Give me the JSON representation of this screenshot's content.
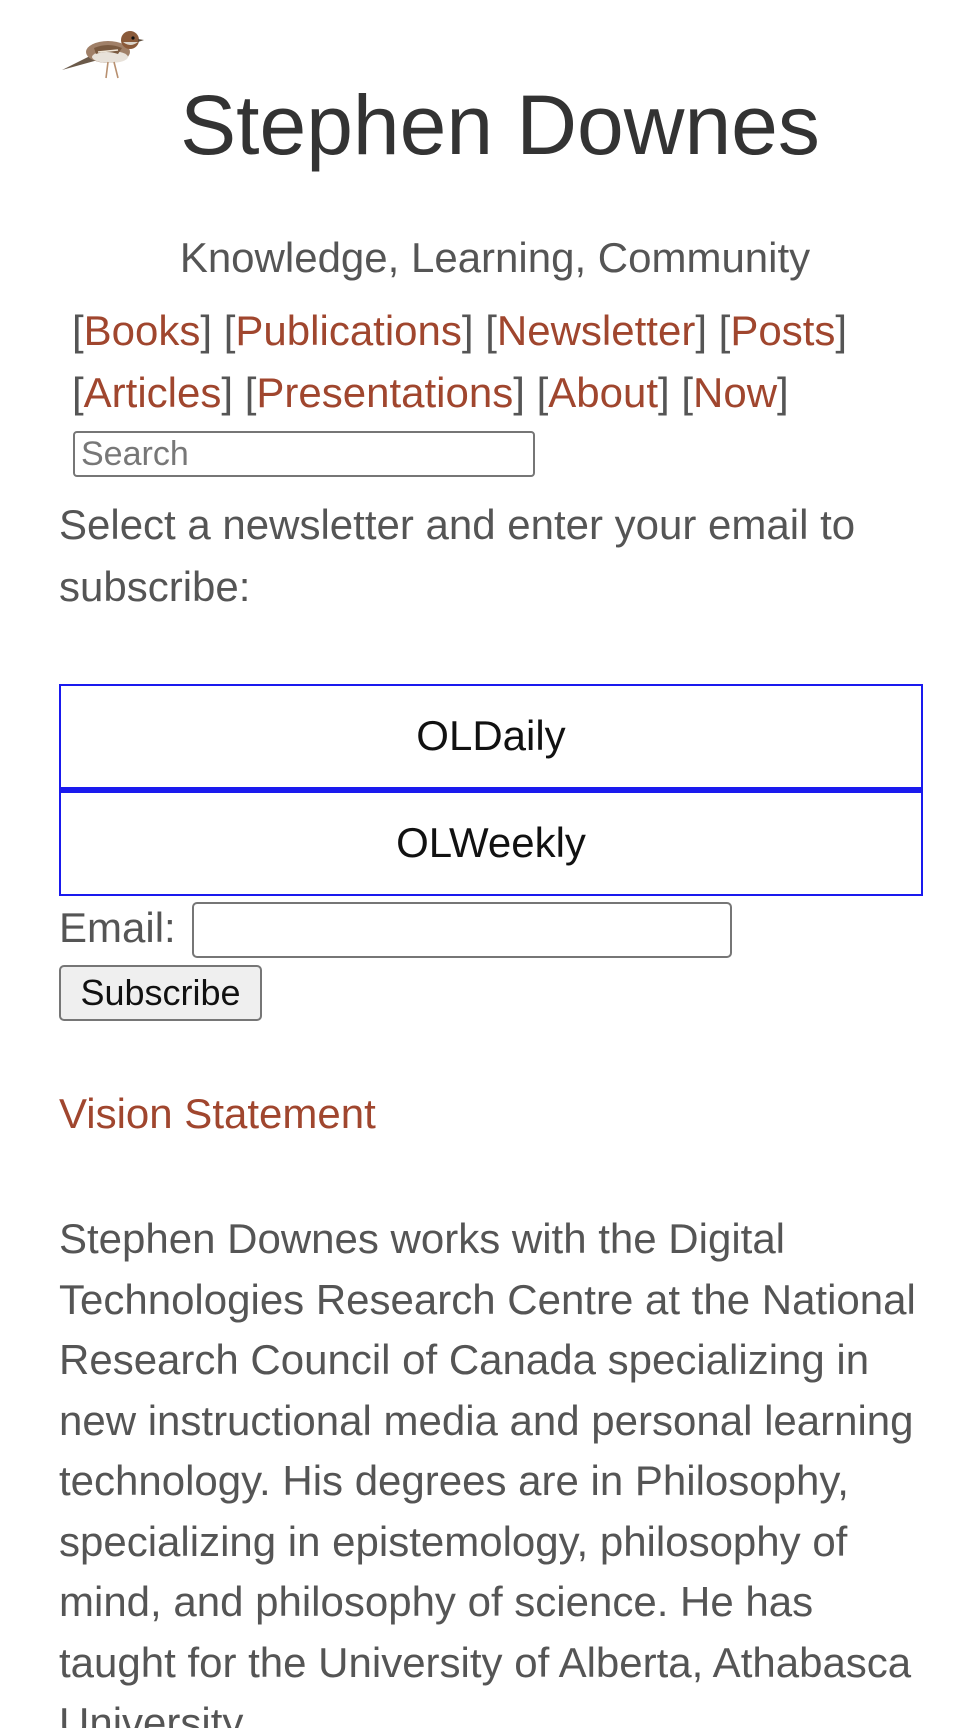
{
  "header": {
    "title": "Stephen Downes",
    "tagline": "Knowledge, Learning, Community",
    "logo_icon": "sparrow-bird-icon"
  },
  "nav": {
    "items": [
      {
        "label": "Books"
      },
      {
        "label": "Publications"
      },
      {
        "label": "Newsletter"
      },
      {
        "label": "Posts"
      },
      {
        "label": "Articles"
      },
      {
        "label": "Presentations"
      },
      {
        "label": "About"
      },
      {
        "label": "Now"
      }
    ]
  },
  "search": {
    "placeholder": "Search",
    "value": ""
  },
  "subscribe": {
    "intro": "Select a newsletter and enter your email to subscribe:",
    "options": [
      {
        "label": "OLDaily"
      },
      {
        "label": "OLWeekly"
      }
    ],
    "email_label": "Email:",
    "email_value": "",
    "button_label": "Subscribe",
    "option_border_color": "#1a1aee"
  },
  "vision": {
    "link_label": "Vision Statement",
    "bio": "Stephen Downes works with the Digital Technologies Research Centre at the National Research Council of Canada specializing in new instructional media and personal learning technology. His degrees are in Philosophy, specializing in epistemology, philosophy of mind, and philosophy of science. He has taught for the University of Alberta, Athabasca University"
  },
  "colors": {
    "link": "#a0462e",
    "text": "#555555",
    "title": "#333333"
  }
}
